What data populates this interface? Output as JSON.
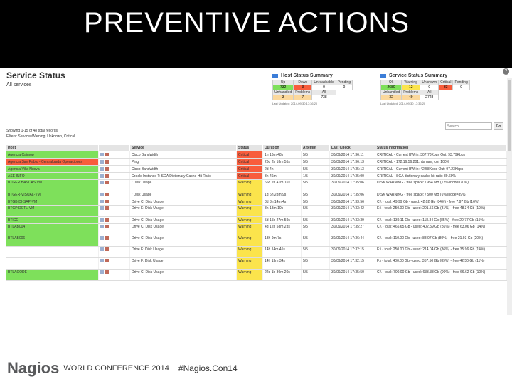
{
  "slide": {
    "title": "PREVENTIVE ACTIONS"
  },
  "page": {
    "title": "Service Status",
    "subtitle": "All services",
    "help": "?"
  },
  "host_summary": {
    "title": "Host Status Summary",
    "headers1": [
      "Up",
      "Down",
      "Unreachable",
      "Pending"
    ],
    "values1": [
      "732",
      "3",
      "0",
      "0"
    ],
    "headers2": [
      "Unhandled",
      "Problems",
      "All"
    ],
    "values2": [
      "3",
      "7",
      "738"
    ],
    "updated": "Last Updated: 2014-09-30 17:36:20"
  },
  "service_summary": {
    "title": "Service Status Summary",
    "headers1": [
      "Ok",
      "Warning",
      "Unknown",
      "Critical",
      "Pending"
    ],
    "values1": [
      "2680",
      "12",
      "0",
      "33",
      "0"
    ],
    "headers2": [
      "Unhandled",
      "Problems",
      "All"
    ],
    "values2": [
      "32",
      "49",
      "2728"
    ],
    "updated": "Last Updated: 2014-09-30 17:36:20"
  },
  "search": {
    "placeholder": "Search...",
    "button": "Go"
  },
  "showing": "Showing 1-15 of 48 total records",
  "filters": "Filters: Service=Warning, Unknown, Critical",
  "columns": [
    "Host",
    "",
    "Service",
    "Status",
    "Duration",
    "Attempt",
    "Last Check",
    "Status Information"
  ],
  "rows": [
    {
      "host": "Agencia Caimop",
      "service": "Cisco Bandwidth",
      "status": "Critical",
      "duration": "1h 16m 48s",
      "attempt": "5/5",
      "check": "30/09/2014 17:36:11",
      "info": "CRITICAL - Current BW in: 307.70Kbps Out: 93.79Kbps",
      "hostColor": "green",
      "statusColor": "crit"
    },
    {
      "host": "Agencia San Pablo - Centralizada Operaciones",
      "service": "Ping",
      "status": "Critical",
      "duration": "26d 2h 18m 55s",
      "attempt": "5/5",
      "check": "30/09/2014 17:36:13",
      "info": "CRITICAL - 172.16.56.201: rta nan, lost 100%",
      "hostColor": "red",
      "statusColor": "crit"
    },
    {
      "host": "Agencia Villa Nueva I",
      "service": "Cisco Bandwidth",
      "status": "Critical",
      "duration": "2d 4h",
      "attempt": "5/5",
      "check": "30/09/2014 17:35:13",
      "info": "CRITICAL - Current BW in: 42.58Kbps Out: 97.23Kbps",
      "hostColor": "green",
      "statusColor": "crit"
    },
    {
      "host": "ASE-INFO",
      "service": "Oracle Instance T: SGA Dictionary Cache Hit Ratio",
      "status": "Critical",
      "duration": "3h 46m",
      "attempt": "1/5",
      "check": "30/09/2014 17:35:00",
      "info": "CRITICAL - SGA dictionary cache hit ratio 89.69%",
      "hostColor": "green",
      "statusColor": "crit"
    },
    {
      "host": "BTGER BANCAS VM",
      "service": "/ Disk Usage",
      "status": "Warning",
      "duration": "66d 2h 41m 16s",
      "attempt": "5/5",
      "check": "30/09/2014 17:35:06",
      "info": "DISK WARNING - free space: / 954 MB (12% inode=70%)",
      "hostColor": "green",
      "statusColor": "warn",
      "tall": true
    },
    {
      "host": "BTGER-VISUAL-VM",
      "service": "/ Disk Usage",
      "status": "Warning",
      "duration": "1d 6h 28m 9s",
      "attempt": "5/5",
      "check": "30/09/2014 17:35:06",
      "info": "DISK WARNING - free space: / 500 MB (6% inode=89%)",
      "hostColor": "green",
      "statusColor": "warn"
    },
    {
      "host": "BTGB-DI-SAP-VM",
      "service": "Drive C: Disk Usage",
      "status": "Warning",
      "duration": "8d 3h 14m 4s",
      "attempt": "5/5",
      "check": "30/09/2014 17:33:56",
      "info": "C:\\ - total: 49.99 Gb - used: 42.02 Gb (84%) - free 7.97 Gb (16%)",
      "hostColor": "green",
      "statusColor": "warn"
    },
    {
      "host": "BTGPIDCTL-VM",
      "service": "Drive E: Disk Usage",
      "status": "Warning",
      "duration": "8h 18m 10s",
      "attempt": "5/5",
      "check": "30/09/2014 17:33:42",
      "info": "E:\\ - total: 250.00 Gb - used: 201.56 Gb (81%) - free 48.34 Gb (19%)",
      "hostColor": "green",
      "statusColor": "warn",
      "tall": true
    },
    {
      "host": "BTICO",
      "service": "Drive C: Disk Usage",
      "status": "Warning",
      "duration": "5d 15h 27m 59s",
      "attempt": "5/5",
      "check": "30/09/2014 17:33:39",
      "info": "C:\\ - total: 139.11 Gb - used: 118.34 Gb (85%) - free 20.77 Gb (15%)",
      "hostColor": "green",
      "statusColor": "warn"
    },
    {
      "host": "BTLAB004",
      "service": "Drive C: Disk Usage",
      "status": "Warning",
      "duration": "4d 12h 58m 23s",
      "attempt": "5/5",
      "check": "30/09/2014 17:35:27",
      "info": "C:\\ - total: 465.65 Gb - used: 402.59 Gb (86%) - free 63.06 Gb (14%)",
      "hostColor": "green",
      "statusColor": "warn",
      "tall": true
    },
    {
      "host": "BTLAB006",
      "service": "Drive C: Disk Usage",
      "status": "Warning",
      "duration": "13h 9m 7s",
      "attempt": "5/5",
      "check": "30/09/2014 17:36:44",
      "info": "C:\\ - total: 110.00 Gb - used: 88.07 Gb (80%) - free 21.93 Gb (20%)",
      "hostColor": "green",
      "statusColor": "warn",
      "tall": true
    },
    {
      "host": "",
      "service": "Drive E: Disk Usage",
      "status": "Warning",
      "duration": "14h 14m 45s",
      "attempt": "5/5",
      "check": "30/09/2014 17:32:15",
      "info": "E:\\ - total: 250.00 Gb - used: 214.04 Gb (86%) - free 35.96 Gb (14%)",
      "hostColor": "plain",
      "statusColor": "warn",
      "tall": true
    },
    {
      "host": "",
      "service": "Drive F: Disk Usage",
      "status": "Warning",
      "duration": "14h 13m 34s",
      "attempt": "5/5",
      "check": "30/09/2014 17:32:15",
      "info": "F:\\ - total: 400.00 Gb - used: 357.50 Gb (89%) - free 42.50 Gb (11%)",
      "hostColor": "plain",
      "statusColor": "warn",
      "tall": true
    },
    {
      "host": "BTLACODE",
      "service": "Drive C: Disk Usage",
      "status": "Warning",
      "duration": "22d 1h 30m 20s",
      "attempt": "5/5",
      "check": "30/09/2014 17:35:50",
      "info": "C:\\ - total: 700.00 Gb - used: 633.38 Gb (90%) - free 66.62 Gb (10%)",
      "hostColor": "green",
      "statusColor": "warn",
      "tall": true
    }
  ],
  "footer": {
    "brand": "Nagios",
    "conference": "WORLD CONFERENCE 2014",
    "hashtag": "#Nagios.Con14"
  }
}
